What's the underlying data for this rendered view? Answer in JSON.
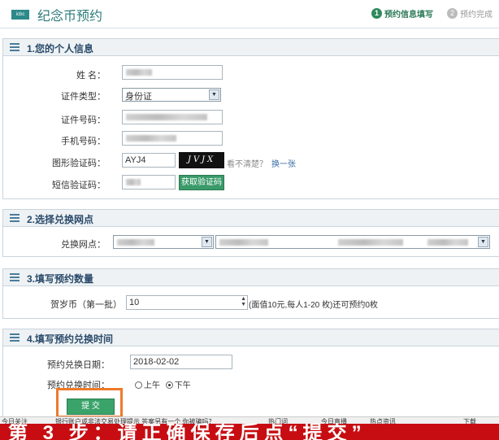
{
  "app": {
    "logo_text": "icbc",
    "title": "纪念币预约"
  },
  "steps": [
    {
      "num": "1",
      "label": "预约信息填写"
    },
    {
      "num": "2",
      "label": "预约完成"
    }
  ],
  "sections": {
    "personal": {
      "title": "1.您的个人信息",
      "name_label": "姓    名：",
      "id_type_label": "证件类型：",
      "id_type_value": "身份证",
      "id_number_label": "证件号码：",
      "phone_label": "手机号码：",
      "captcha_label": "图形验证码：",
      "captcha_value": "AYJ4",
      "captcha_image_text": "JVJX",
      "captcha_hint": "看不清楚？",
      "captcha_refresh": "换一张",
      "sms_label": "短信验证码：",
      "sms_button": "获取验证码"
    },
    "branch": {
      "title": "2.选择兑换网点",
      "label": "兑换网点："
    },
    "quantity": {
      "title": "3.填写预约数量",
      "label": "贺岁币（第一批）",
      "value": "10",
      "note": "(面值10元,每人1-20 枚)还可预约0枚"
    },
    "time": {
      "title": "4.填写预约兑换时间",
      "date_label": "预约兑换日期：",
      "date_value": "2018-02-02",
      "period_label": "预约兑换时间：",
      "am": "上午",
      "pm": "下午",
      "submit": "提 交"
    }
  },
  "statusbar": {
    "left": "今日关注",
    "news": "银行账户或非法交易处理提示 答案另有一个 你被骗吗？",
    "items": [
      "热门词",
      "今日直播",
      "热点资讯",
      "下载"
    ]
  },
  "banner": {
    "text": "第 3 步：请正确保存后点“提交”"
  }
}
